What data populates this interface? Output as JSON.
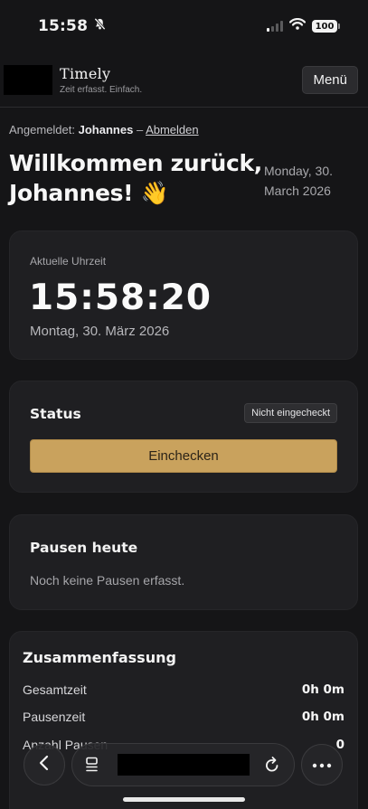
{
  "status_bar": {
    "time": "15:58",
    "battery": "100",
    "colors": {
      "signal_active": "#f2f2f2",
      "signal_inactive": "#5a5a5c"
    }
  },
  "header": {
    "brand": "Timely",
    "tagline": "Zeit erfasst. Einfach.",
    "menu_label": "Menü"
  },
  "session": {
    "prefix": "Angemeldet:",
    "user": "Johannes",
    "separator": "–",
    "logout_label": "Abmelden"
  },
  "welcome": {
    "line1": "Willkommen zurück,",
    "line2": "Johannes!",
    "emoji": "👋",
    "date_line1": "Monday, 30.",
    "date_line2": "March 2026"
  },
  "clock_card": {
    "label": "Aktuelle Uhrzeit",
    "time": "15:58:20",
    "date": "Montag, 30. März 2026"
  },
  "status_card": {
    "title": "Status",
    "badge": "Nicht eingecheckt",
    "button": "Einchecken",
    "accent_color": "#c9a25d"
  },
  "breaks_card": {
    "title": "Pausen heute",
    "empty_text": "Noch keine Pausen erfasst."
  },
  "summary_card": {
    "title": "Zusammenfassung",
    "rows": [
      {
        "label": "Gesamtzeit",
        "value": "0h 0m"
      },
      {
        "label": "Pausenzeit",
        "value": "0h 0m"
      },
      {
        "label": "Anzahl Pausen",
        "value": "0"
      }
    ]
  },
  "toolbar": {
    "back_icon": "chevron-left-icon",
    "tabs_icon": "tabs-icon",
    "reload_icon": "reload-icon",
    "more_icon": "ellipsis-icon"
  }
}
